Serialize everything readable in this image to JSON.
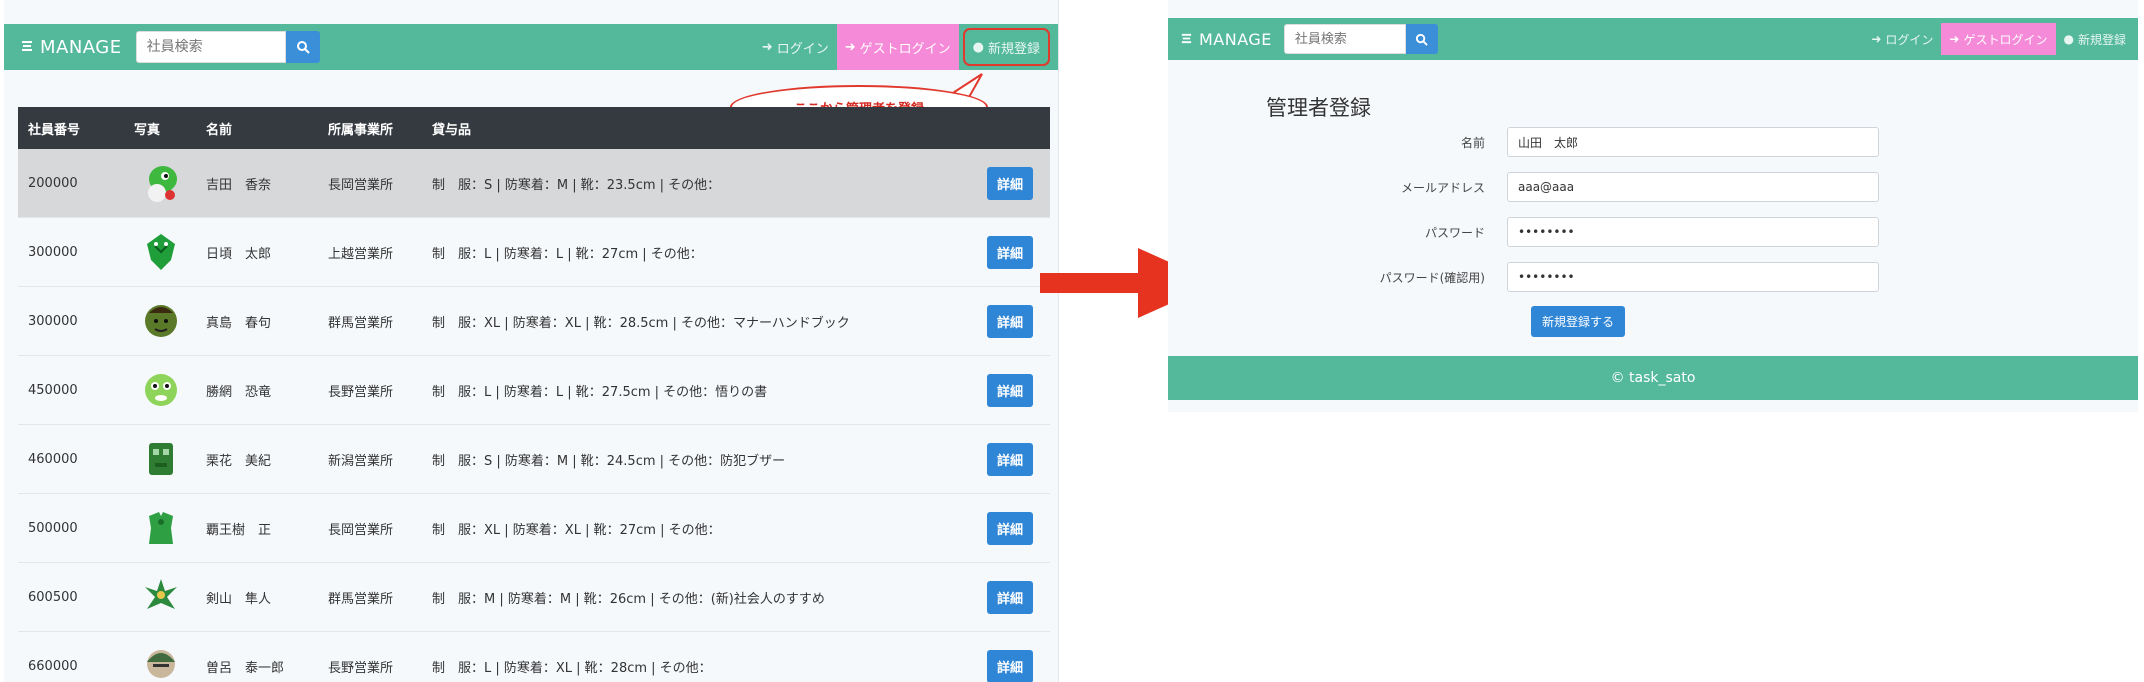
{
  "left": {
    "nav": {
      "brand": "MANAGE",
      "search_placeholder": "社員検索",
      "login": "ログイン",
      "guest_login": "ゲストログイン",
      "register": "新規登録"
    },
    "callout": "ここから管理者を登録",
    "table": {
      "headers": [
        "社員番号",
        "写真",
        "名前",
        "所属事業所",
        "貸与品"
      ],
      "detail_label": "詳細",
      "rows": [
        {
          "id": "200000",
          "name": "吉田　香奈",
          "office": "長岡営業所",
          "items": "制　服：S | 防寒着：M | 靴：23.5cm | その他："
        },
        {
          "id": "300000",
          "name": "日頃　太郎",
          "office": "上越営業所",
          "items": "制　服：L | 防寒着：L | 靴：27cm | その他："
        },
        {
          "id": "300000",
          "name": "真島　春句",
          "office": "群馬営業所",
          "items": "制　服：XL | 防寒着：XL | 靴：28.5cm | その他：マナーハンドブック"
        },
        {
          "id": "450000",
          "name": "勝網　恐竜",
          "office": "長野営業所",
          "items": "制　服：L | 防寒着：L | 靴：27.5cm | その他：悟りの書"
        },
        {
          "id": "460000",
          "name": "栗花　美紀",
          "office": "新潟営業所",
          "items": "制　服：S | 防寒着：M | 靴：24.5cm | その他：防犯ブザー"
        },
        {
          "id": "500000",
          "name": "覇王樹　正",
          "office": "長岡営業所",
          "items": "制　服：XL | 防寒着：XL | 靴：27cm | その他："
        },
        {
          "id": "600500",
          "name": "剣山　隼人",
          "office": "群馬営業所",
          "items": "制　服：M | 防寒着：M | 靴：26cm | その他：(新)社会人のすすめ"
        },
        {
          "id": "660000",
          "name": "曽呂　泰一郎",
          "office": "長野営業所",
          "items": "制　服：L | 防寒着：XL | 靴：28cm | その他："
        }
      ]
    }
  },
  "right": {
    "nav": {
      "brand": "MANAGE",
      "search_placeholder": "社員検索",
      "login": "ログイン",
      "guest_login": "ゲストログイン",
      "register": "新規登録"
    },
    "form": {
      "title": "管理者登録",
      "name_label": "名前",
      "name_value": "山田　太郎",
      "email_label": "メールアドレス",
      "email_value": "aaa@aaa",
      "password_label": "パスワード",
      "password_value": "••••••••",
      "password_confirm_label": "パスワード(確認用)",
      "password_confirm_value": "••••••••",
      "submit": "新規登録する"
    },
    "footer": "© task_sato"
  },
  "colors": {
    "navbar": "#53b99a",
    "guest_button": "#f58ad8",
    "primary_button": "#2f86d6",
    "table_header": "#343a40",
    "highlight": "#e03a2f"
  }
}
